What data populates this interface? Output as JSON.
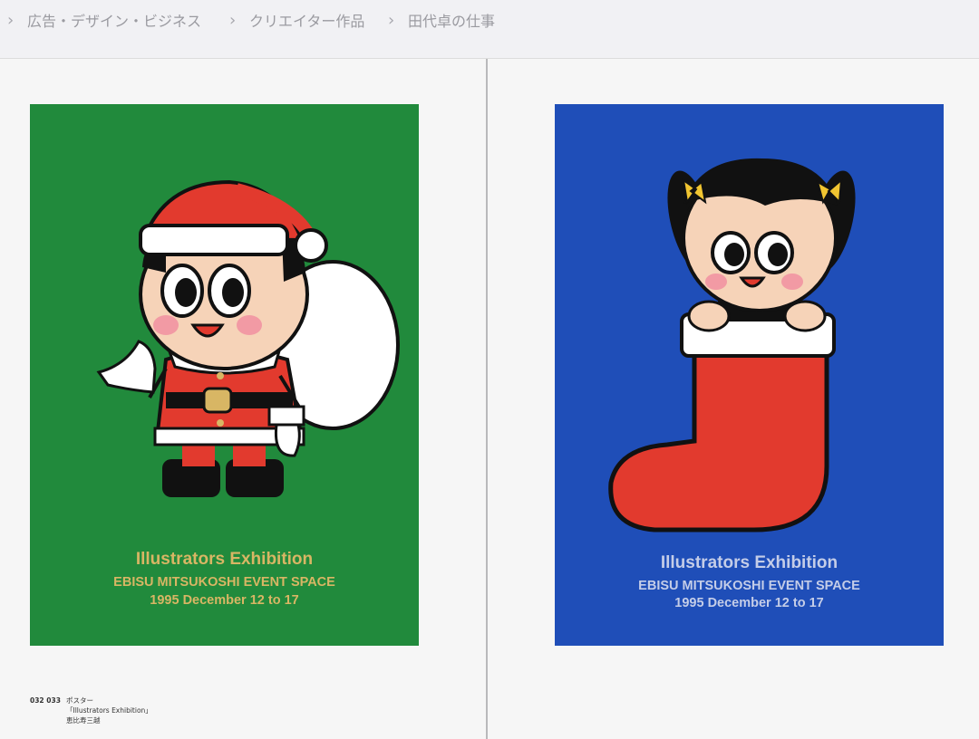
{
  "breadcrumb": {
    "items": [
      {
        "label": "広告・デザイン・ビジネス"
      },
      {
        "label": "クリエイター作品"
      },
      {
        "label": "田代卓の仕事"
      }
    ]
  },
  "posters": [
    {
      "background": "#218a3c",
      "title": "Illustrators Exhibition",
      "venue": "EBISU MITSUKOSHI EVENT SPACE",
      "dates": "1995 December 12 to 17"
    },
    {
      "background": "#1f4eb8",
      "title": "Illustrators Exhibition",
      "venue": "EBISU MITSUKOSHI EVENT SPACE",
      "dates": "1995 December 12 to 17"
    }
  ],
  "caption": {
    "page_numbers": "032 033",
    "type": "ポスター",
    "title": "「Illustrators Exhibition」",
    "client": "恵比寿三越"
  }
}
